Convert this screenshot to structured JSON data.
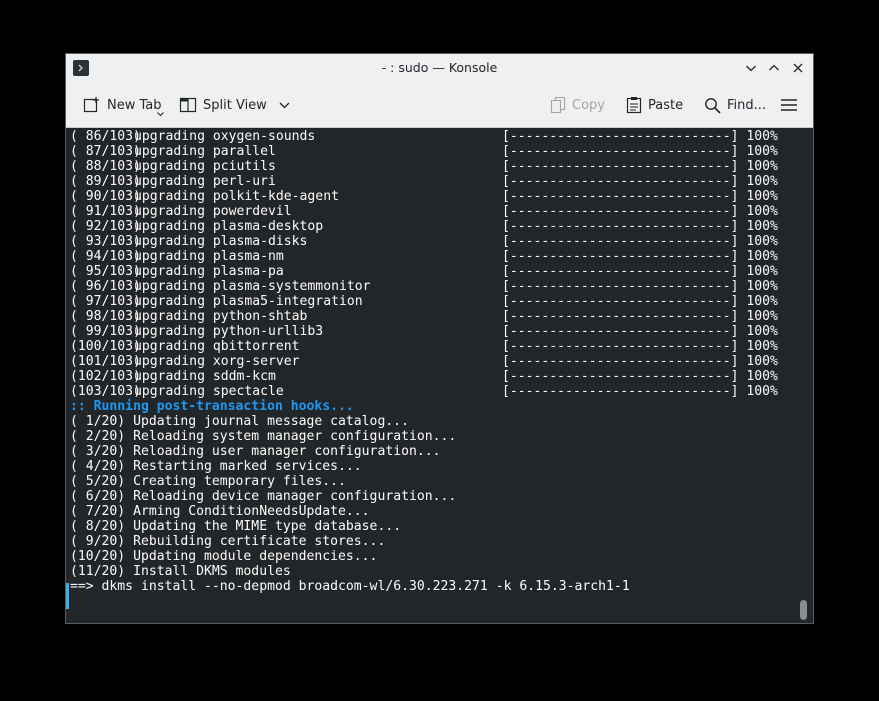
{
  "window": {
    "title": "- : sudo — Konsole"
  },
  "toolbar": {
    "new_tab": "New Tab",
    "split_view": "Split View",
    "copy": "Copy",
    "paste": "Paste",
    "find": "Find..."
  },
  "upgrades": [
    {
      "num": "( 86/103)",
      "pkg": "upgrading oxygen-sounds"
    },
    {
      "num": "( 87/103)",
      "pkg": "upgrading parallel"
    },
    {
      "num": "( 88/103)",
      "pkg": "upgrading pciutils"
    },
    {
      "num": "( 89/103)",
      "pkg": "upgrading perl-uri"
    },
    {
      "num": "( 90/103)",
      "pkg": "upgrading polkit-kde-agent"
    },
    {
      "num": "( 91/103)",
      "pkg": "upgrading powerdevil"
    },
    {
      "num": "( 92/103)",
      "pkg": "upgrading plasma-desktop"
    },
    {
      "num": "( 93/103)",
      "pkg": "upgrading plasma-disks"
    },
    {
      "num": "( 94/103)",
      "pkg": "upgrading plasma-nm"
    },
    {
      "num": "( 95/103)",
      "pkg": "upgrading plasma-pa"
    },
    {
      "num": "( 96/103)",
      "pkg": "upgrading plasma-systemmonitor"
    },
    {
      "num": "( 97/103)",
      "pkg": "upgrading plasma5-integration"
    },
    {
      "num": "( 98/103)",
      "pkg": "upgrading python-shtab"
    },
    {
      "num": "( 99/103)",
      "pkg": "upgrading python-urllib3"
    },
    {
      "num": "(100/103)",
      "pkg": "upgrading qbittorrent"
    },
    {
      "num": "(101/103)",
      "pkg": "upgrading xorg-server"
    },
    {
      "num": "(102/103)",
      "pkg": "upgrading sddm-kcm"
    },
    {
      "num": "(103/103)",
      "pkg": "upgrading spectacle"
    }
  ],
  "progress_bar": "[----------------------------] 100%",
  "hooks_title": ":: Running post-transaction hooks...",
  "hooks": [
    "( 1/20) Updating journal message catalog...",
    "( 2/20) Reloading system manager configuration...",
    "( 3/20) Reloading user manager configuration...",
    "( 4/20) Restarting marked services...",
    "( 5/20) Creating temporary files...",
    "( 6/20) Reloading device manager configuration...",
    "( 7/20) Arming ConditionNeedsUpdate...",
    "( 8/20) Updating the MIME type database...",
    "( 9/20) Rebuilding certificate stores...",
    "(10/20) Updating module dependencies...",
    "(11/20) Install DKMS modules"
  ],
  "prompt_line": "==> dkms install --no-depmod broadcom-wl/6.30.223.271 -k 6.15.3-arch1-1"
}
